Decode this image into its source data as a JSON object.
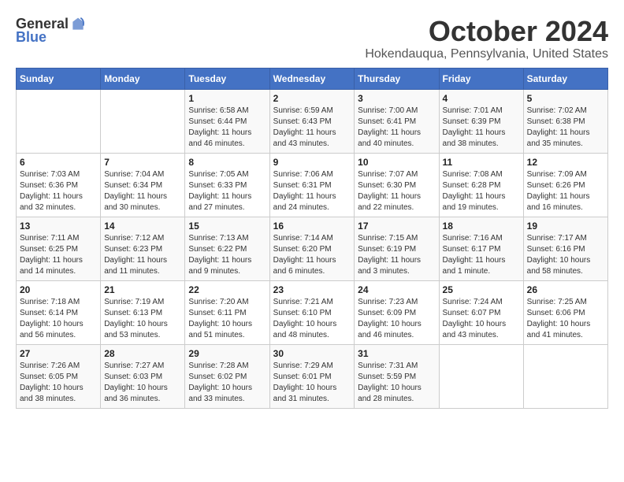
{
  "logo": {
    "general": "General",
    "blue": "Blue"
  },
  "title": "October 2024",
  "location": "Hokendauqua, Pennsylvania, United States",
  "days_header": [
    "Sunday",
    "Monday",
    "Tuesday",
    "Wednesday",
    "Thursday",
    "Friday",
    "Saturday"
  ],
  "weeks": [
    [
      {
        "day": "",
        "content": ""
      },
      {
        "day": "",
        "content": ""
      },
      {
        "day": "1",
        "content": "Sunrise: 6:58 AM\nSunset: 6:44 PM\nDaylight: 11 hours and 46 minutes."
      },
      {
        "day": "2",
        "content": "Sunrise: 6:59 AM\nSunset: 6:43 PM\nDaylight: 11 hours and 43 minutes."
      },
      {
        "day": "3",
        "content": "Sunrise: 7:00 AM\nSunset: 6:41 PM\nDaylight: 11 hours and 40 minutes."
      },
      {
        "day": "4",
        "content": "Sunrise: 7:01 AM\nSunset: 6:39 PM\nDaylight: 11 hours and 38 minutes."
      },
      {
        "day": "5",
        "content": "Sunrise: 7:02 AM\nSunset: 6:38 PM\nDaylight: 11 hours and 35 minutes."
      }
    ],
    [
      {
        "day": "6",
        "content": "Sunrise: 7:03 AM\nSunset: 6:36 PM\nDaylight: 11 hours and 32 minutes."
      },
      {
        "day": "7",
        "content": "Sunrise: 7:04 AM\nSunset: 6:34 PM\nDaylight: 11 hours and 30 minutes."
      },
      {
        "day": "8",
        "content": "Sunrise: 7:05 AM\nSunset: 6:33 PM\nDaylight: 11 hours and 27 minutes."
      },
      {
        "day": "9",
        "content": "Sunrise: 7:06 AM\nSunset: 6:31 PM\nDaylight: 11 hours and 24 minutes."
      },
      {
        "day": "10",
        "content": "Sunrise: 7:07 AM\nSunset: 6:30 PM\nDaylight: 11 hours and 22 minutes."
      },
      {
        "day": "11",
        "content": "Sunrise: 7:08 AM\nSunset: 6:28 PM\nDaylight: 11 hours and 19 minutes."
      },
      {
        "day": "12",
        "content": "Sunrise: 7:09 AM\nSunset: 6:26 PM\nDaylight: 11 hours and 16 minutes."
      }
    ],
    [
      {
        "day": "13",
        "content": "Sunrise: 7:11 AM\nSunset: 6:25 PM\nDaylight: 11 hours and 14 minutes."
      },
      {
        "day": "14",
        "content": "Sunrise: 7:12 AM\nSunset: 6:23 PM\nDaylight: 11 hours and 11 minutes."
      },
      {
        "day": "15",
        "content": "Sunrise: 7:13 AM\nSunset: 6:22 PM\nDaylight: 11 hours and 9 minutes."
      },
      {
        "day": "16",
        "content": "Sunrise: 7:14 AM\nSunset: 6:20 PM\nDaylight: 11 hours and 6 minutes."
      },
      {
        "day": "17",
        "content": "Sunrise: 7:15 AM\nSunset: 6:19 PM\nDaylight: 11 hours and 3 minutes."
      },
      {
        "day": "18",
        "content": "Sunrise: 7:16 AM\nSunset: 6:17 PM\nDaylight: 11 hours and 1 minute."
      },
      {
        "day": "19",
        "content": "Sunrise: 7:17 AM\nSunset: 6:16 PM\nDaylight: 10 hours and 58 minutes."
      }
    ],
    [
      {
        "day": "20",
        "content": "Sunrise: 7:18 AM\nSunset: 6:14 PM\nDaylight: 10 hours and 56 minutes."
      },
      {
        "day": "21",
        "content": "Sunrise: 7:19 AM\nSunset: 6:13 PM\nDaylight: 10 hours and 53 minutes."
      },
      {
        "day": "22",
        "content": "Sunrise: 7:20 AM\nSunset: 6:11 PM\nDaylight: 10 hours and 51 minutes."
      },
      {
        "day": "23",
        "content": "Sunrise: 7:21 AM\nSunset: 6:10 PM\nDaylight: 10 hours and 48 minutes."
      },
      {
        "day": "24",
        "content": "Sunrise: 7:23 AM\nSunset: 6:09 PM\nDaylight: 10 hours and 46 minutes."
      },
      {
        "day": "25",
        "content": "Sunrise: 7:24 AM\nSunset: 6:07 PM\nDaylight: 10 hours and 43 minutes."
      },
      {
        "day": "26",
        "content": "Sunrise: 7:25 AM\nSunset: 6:06 PM\nDaylight: 10 hours and 41 minutes."
      }
    ],
    [
      {
        "day": "27",
        "content": "Sunrise: 7:26 AM\nSunset: 6:05 PM\nDaylight: 10 hours and 38 minutes."
      },
      {
        "day": "28",
        "content": "Sunrise: 7:27 AM\nSunset: 6:03 PM\nDaylight: 10 hours and 36 minutes."
      },
      {
        "day": "29",
        "content": "Sunrise: 7:28 AM\nSunset: 6:02 PM\nDaylight: 10 hours and 33 minutes."
      },
      {
        "day": "30",
        "content": "Sunrise: 7:29 AM\nSunset: 6:01 PM\nDaylight: 10 hours and 31 minutes."
      },
      {
        "day": "31",
        "content": "Sunrise: 7:31 AM\nSunset: 5:59 PM\nDaylight: 10 hours and 28 minutes."
      },
      {
        "day": "",
        "content": ""
      },
      {
        "day": "",
        "content": ""
      }
    ]
  ]
}
